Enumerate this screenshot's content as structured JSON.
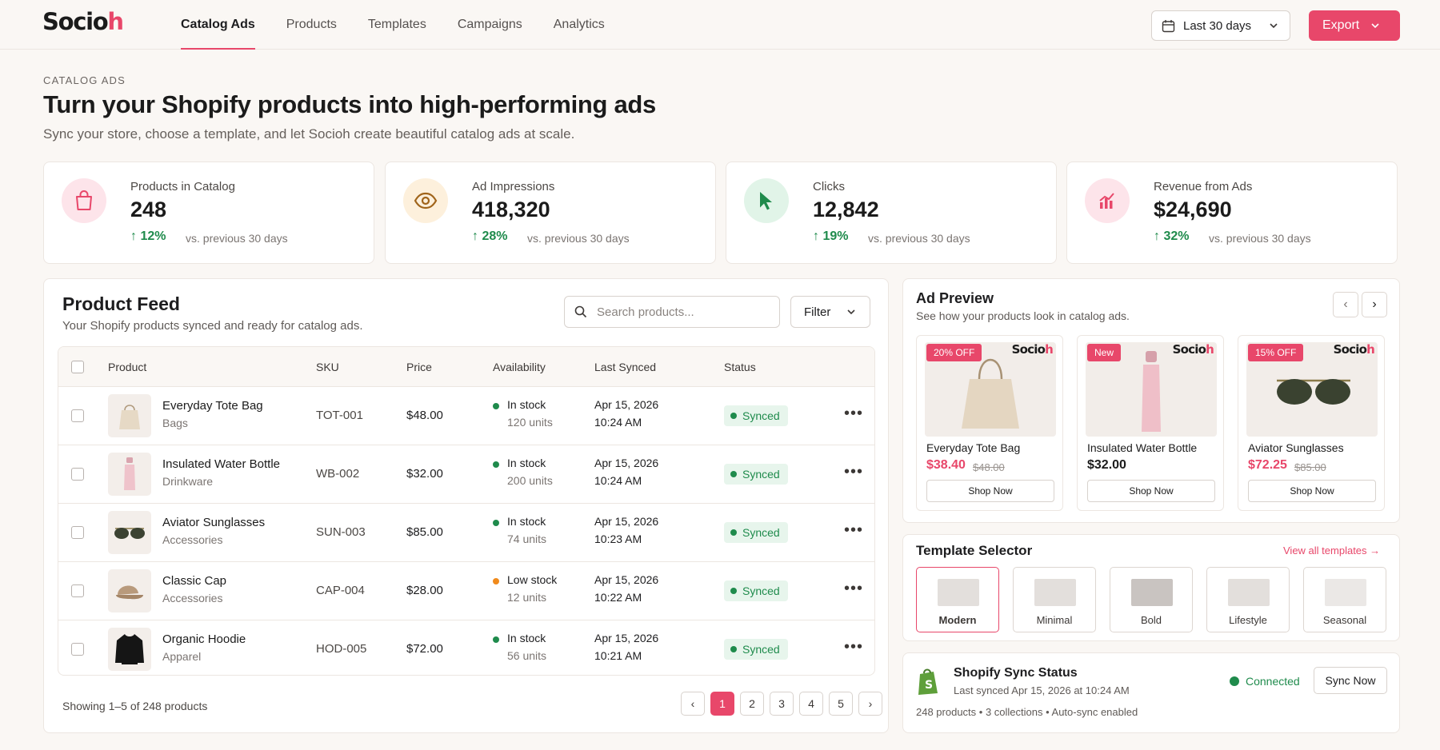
{
  "brand": {
    "logo_main": "Socio",
    "logo_accent": "h"
  },
  "nav": {
    "items": [
      "Catalog Ads",
      "Products",
      "Templates",
      "Campaigns",
      "Analytics"
    ]
  },
  "header": {
    "date_range": "Last 30 days",
    "export_label": "Export"
  },
  "page": {
    "eyebrow": "CATALOG ADS",
    "title": "Turn your Shopify products into high-performing ads",
    "subtitle": "Sync your store, choose a template, and let Socioh create beautiful catalog ads at scale."
  },
  "stats": [
    {
      "label": "Products in Catalog",
      "value": "248",
      "change": "12%",
      "compare": "vs. previous 30 days",
      "icon": "shopping-bag-icon"
    },
    {
      "label": "Ad Impressions",
      "value": "418,320",
      "change": "28%",
      "compare": "vs. previous 30 days",
      "icon": "eye-icon"
    },
    {
      "label": "Clicks",
      "value": "12,842",
      "change": "19%",
      "compare": "vs. previous 30 days",
      "icon": "cursor-icon"
    },
    {
      "label": "Revenue from Ads",
      "value": "$24,690",
      "change": "32%",
      "compare": "vs. previous 30 days",
      "icon": "bar-chart-icon"
    }
  ],
  "feed": {
    "title": "Product Feed",
    "subtitle": "Your Shopify products synced and ready for catalog ads.",
    "search_placeholder": "Search products...",
    "filter_label": "Filter",
    "columns": [
      "Product",
      "SKU",
      "Price",
      "Availability",
      "Last Synced",
      "Status"
    ],
    "rows": [
      {
        "name": "Everyday Tote Bag",
        "category": "Bags",
        "sku": "TOT-001",
        "price": "$48.00",
        "availability": "In stock",
        "units": "120 units",
        "date": "Apr 15, 2026",
        "time": "10:24 AM",
        "status": "Synced",
        "avail_color": "#1f8b4c"
      },
      {
        "name": "Insulated Water Bottle",
        "category": "Drinkware",
        "sku": "WB-002",
        "price": "$32.00",
        "availability": "In stock",
        "units": "200 units",
        "date": "Apr 15, 2026",
        "time": "10:24 AM",
        "status": "Synced",
        "avail_color": "#1f8b4c"
      },
      {
        "name": "Aviator Sunglasses",
        "category": "Accessories",
        "sku": "SUN-003",
        "price": "$85.00",
        "availability": "In stock",
        "units": "74 units",
        "date": "Apr 15, 2026",
        "time": "10:23 AM",
        "status": "Synced",
        "avail_color": "#1f8b4c"
      },
      {
        "name": "Classic Cap",
        "category": "Accessories",
        "sku": "CAP-004",
        "price": "$28.00",
        "availability": "Low stock",
        "units": "12 units",
        "date": "Apr 15, 2026",
        "time": "10:22 AM",
        "status": "Synced",
        "avail_color": "#f08a1c"
      },
      {
        "name": "Organic Hoodie",
        "category": "Apparel",
        "sku": "HOD-005",
        "price": "$72.00",
        "availability": "In stock",
        "units": "56 units",
        "date": "Apr 15, 2026",
        "time": "10:21 AM",
        "status": "Synced",
        "avail_color": "#1f8b4c"
      }
    ],
    "showing": "Showing 1–5 of 248 products",
    "pages": [
      "1",
      "2",
      "3",
      "4",
      "5"
    ]
  },
  "preview": {
    "title": "Ad Preview",
    "subtitle": "See how your products look in catalog ads.",
    "ads": [
      {
        "tag": "20% OFF",
        "name": "Everyday Tote Bag",
        "price": "$38.40",
        "old_price": "$48.00",
        "cta": "Shop Now"
      },
      {
        "tag": "New",
        "name": "Insulated Water Bottle",
        "price": "$32.00",
        "old_price": "",
        "cta": "Shop Now"
      },
      {
        "tag": "15% OFF",
        "name": "Aviator Sunglasses",
        "price": "$72.25",
        "old_price": "$85.00",
        "cta": "Shop Now"
      }
    ]
  },
  "templates": {
    "title": "Template Selector",
    "view_all": "View all templates",
    "items": [
      "Modern",
      "Minimal",
      "Bold",
      "Lifestyle",
      "Seasonal"
    ]
  },
  "sync": {
    "title": "Shopify Sync Status",
    "last_synced": "Last synced Apr 15, 2026 at 10:24 AM",
    "details": "248 products • 3 collections • Auto-sync enabled",
    "status": "Connected",
    "button": "Sync Now"
  },
  "colors": {
    "accent": "#e8476a",
    "success": "#1f8b4c",
    "warning": "#f08a1c"
  }
}
